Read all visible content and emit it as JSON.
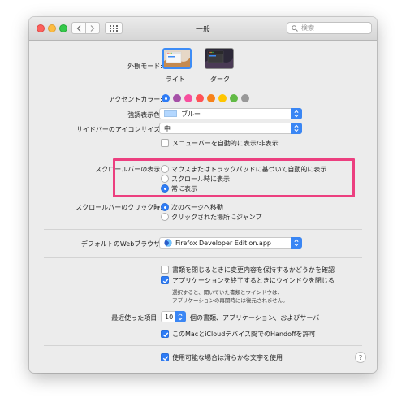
{
  "window": {
    "title": "一般"
  },
  "search": {
    "placeholder": "検索"
  },
  "appearance": {
    "label": "外観モード:",
    "options": [
      {
        "label": "ライト",
        "selected": true
      },
      {
        "label": "ダーク",
        "selected": false
      }
    ]
  },
  "accent": {
    "label": "アクセントカラー:",
    "colors": [
      "#2e7cf6",
      "#a550a7",
      "#f74f9e",
      "#ff5257",
      "#f7821b",
      "#ffc600",
      "#62ba46",
      "#989898"
    ],
    "selected_index": 0
  },
  "highlight": {
    "label": "強調表示色:",
    "value": "ブルー",
    "swatch_color": "#b3d7ff"
  },
  "sidebar_icon_size": {
    "label": "サイドバーのアイコンサイズ:",
    "value": "中"
  },
  "menubar_autohide": {
    "label": "メニューバーを自動的に表示/非表示",
    "checked": false
  },
  "scrollbars": {
    "label": "スクロールバーの表示:",
    "options": [
      {
        "label": "マウスまたはトラックパッドに基づいて自動的に表示",
        "selected": false
      },
      {
        "label": "スクロール時に表示",
        "selected": false
      },
      {
        "label": "常に表示",
        "selected": true
      }
    ]
  },
  "scrollbar_click": {
    "label": "スクロールバーのクリック時:",
    "options": [
      {
        "label": "次のページへ移動",
        "selected": true
      },
      {
        "label": "クリックされた場所にジャンプ",
        "selected": false
      }
    ]
  },
  "browser": {
    "label": "デフォルトのWebブラウザ:",
    "value": "Firefox Developer Edition.app"
  },
  "documents": {
    "ask_keep_changes": {
      "label": "書類を閉じるときに変更内容を保持するかどうかを確認",
      "checked": false
    },
    "close_windows": {
      "label": "アプリケーションを終了するときにウインドウを閉じる",
      "checked": true
    },
    "note_line1": "選択すると、開いていた書類とウインドウは、",
    "note_line2": "アプリケーションの再開時には復元されません。"
  },
  "recent_items": {
    "label": "最近使った項目:",
    "value": "10",
    "suffix": "個の書類、アプリケーション、およびサーバ"
  },
  "handoff": {
    "label": "このMacとiCloudデバイス間でのHandoffを許可",
    "checked": true
  },
  "font_smoothing": {
    "label": "使用可能な場合は滑らかな文字を使用",
    "checked": true
  },
  "help": {
    "label": "?"
  }
}
